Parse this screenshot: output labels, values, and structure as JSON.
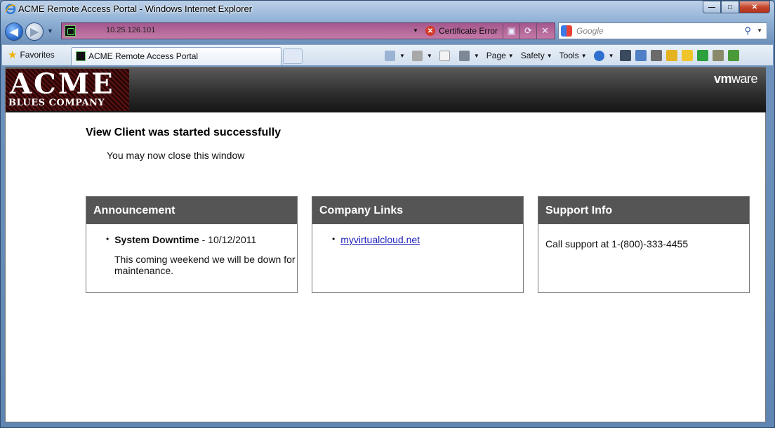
{
  "window": {
    "title": "ACME Remote Access Portal - Windows Internet Explorer",
    "minimize": "—",
    "maximize": "□",
    "close": "✕"
  },
  "navigation": {
    "address": "10.25.126.101",
    "certificate_error": "Certificate Error",
    "search_placeholder": "Google"
  },
  "favorites_bar": {
    "favorites_label": "Favorites",
    "tab_label": "ACME Remote Access Portal",
    "menus": [
      "Page",
      "Safety",
      "Tools"
    ]
  },
  "header": {
    "logo_main": "ACME",
    "logo_sub": "BLUES COMPANY",
    "vmware_bold": "vm",
    "vmware_rest": "ware"
  },
  "status": {
    "title": "View Client was started successfully",
    "message": "You may now close this window"
  },
  "panels": {
    "announcement": {
      "title": "Announcement",
      "item_bold": "System Downtime",
      "item_date": " - 10/12/2011",
      "item_body": "This coming weekend we will be down for maintenance."
    },
    "company_links": {
      "title": "Company Links",
      "link": "myvirtualcloud.net"
    },
    "support_info": {
      "title": "Support Info",
      "text": "Call support at 1-(800)-333-4455"
    }
  },
  "colors": {
    "address_bar": "#b56a9c",
    "panel_header": "#555555",
    "header_bg": "#2c2c2c",
    "link": "#1f1fbf"
  }
}
